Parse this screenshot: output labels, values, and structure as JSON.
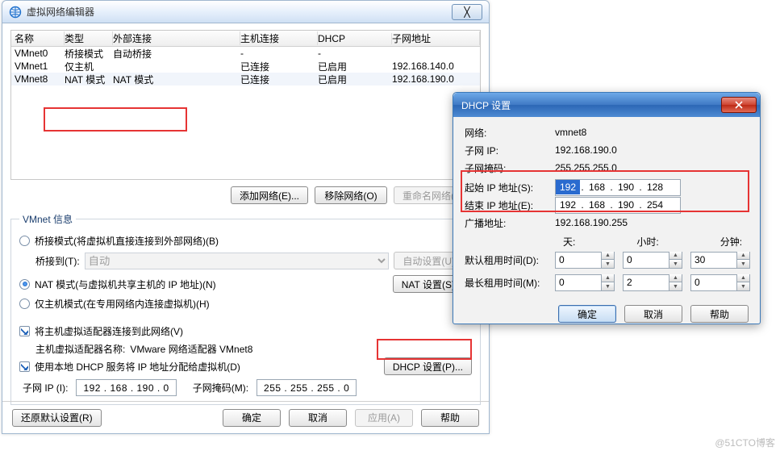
{
  "main": {
    "title": "虚拟网络编辑器",
    "sys_close": "╳",
    "columns": [
      "名称",
      "类型",
      "外部连接",
      "主机连接",
      "DHCP",
      "子网地址"
    ],
    "rows": [
      {
        "name": "VMnet0",
        "type": "桥接模式",
        "ext": "自动桥接",
        "host": "-",
        "dhcp": "-",
        "subnet": ""
      },
      {
        "name": "VMnet1",
        "type": "仅主机",
        "ext": "",
        "host": "已连接",
        "dhcp": "已启用",
        "subnet": "192.168.140.0"
      },
      {
        "name": "VMnet8",
        "type": "NAT 模式",
        "ext": "NAT 模式",
        "host": "已连接",
        "dhcp": "已启用",
        "subnet": "192.168.190.0"
      }
    ],
    "btn_add": "添加网络(E)...",
    "btn_remove": "移除网络(O)",
    "btn_rename": "重命名网络(A)...",
    "fieldset_title": "VMnet 信息",
    "opt_bridge": "桥接模式(将虚拟机直接连接到外部网络)(B)",
    "bridge_to_label": "桥接到(T):",
    "bridge_to_value": "自动",
    "btn_autoset": "自动设置(U)...",
    "opt_nat": "NAT 模式(与虚拟机共享主机的 IP 地址)(N)",
    "btn_natset": "NAT 设置(S)...",
    "opt_hostonly": "仅主机模式(在专用网络内连接虚拟机)(H)",
    "chk_hostconn": "将主机虚拟适配器连接到此网络(V)",
    "hostadapter_label": "主机虚拟适配器名称:",
    "hostadapter_value": "VMware 网络适配器 VMnet8",
    "chk_dhcp": "使用本地 DHCP 服务将 IP 地址分配给虚拟机(D)",
    "btn_dhcp": "DHCP 设置(P)...",
    "subnet_ip_label": "子网 IP (I):",
    "subnet_ip_value": "192 . 168 . 190 .  0",
    "mask_label": "子网掩码(M):",
    "mask_value": "255 . 255 . 255 .  0",
    "btn_restore": "还原默认设置(R)",
    "btn_ok": "确定",
    "btn_cancel": "取消",
    "btn_apply": "应用(A)",
    "btn_help": "帮助"
  },
  "dhcp": {
    "title": "DHCP 设置",
    "lbl_net": "网络:",
    "val_net": "vmnet8",
    "lbl_subip": "子网 IP:",
    "val_subip": "192.168.190.0",
    "lbl_mask": "子网掩码:",
    "val_mask": "255.255.255.0",
    "lbl_start": "起始 IP 地址(S):",
    "start_oct": [
      "192",
      "168",
      "190",
      "128"
    ],
    "lbl_end": "结束 IP 地址(E):",
    "end_oct": [
      "192",
      "168",
      "190",
      "254"
    ],
    "lbl_bcast": "广播地址:",
    "val_bcast": "192.168.190.255",
    "hdr_days": "天:",
    "hdr_hours": "小时:",
    "hdr_mins": "分钟:",
    "lbl_def_lease": "默认租用时间(D):",
    "def_lease": [
      "0",
      "0",
      "30"
    ],
    "lbl_max_lease": "最长租用时间(M):",
    "max_lease": [
      "0",
      "2",
      "0"
    ],
    "btn_ok": "确定",
    "btn_cancel": "取消",
    "btn_help": "帮助"
  },
  "watermark": "@51CTO博客"
}
